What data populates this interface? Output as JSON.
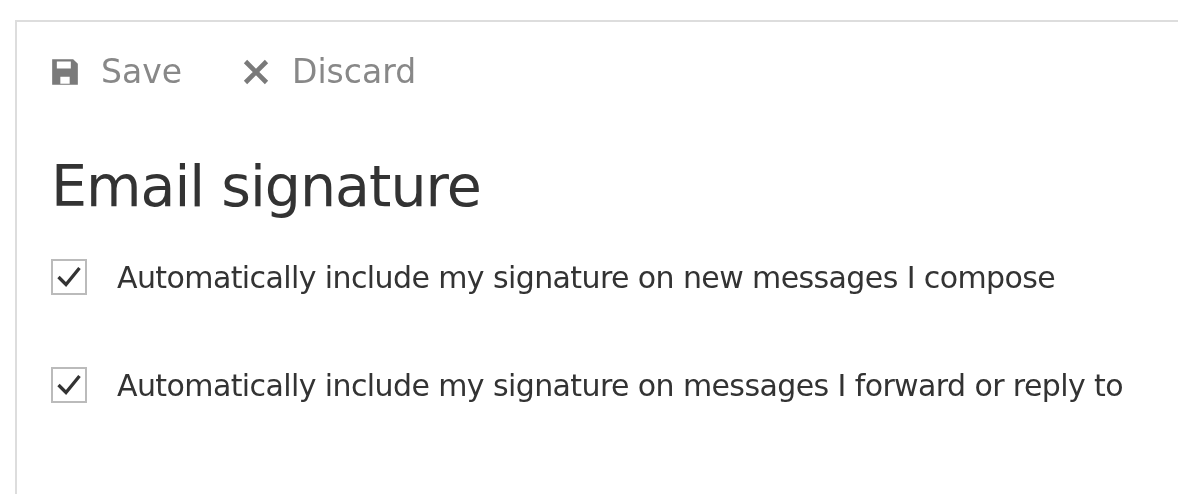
{
  "toolbar": [
    {
      "kind": "save",
      "label": "Save"
    },
    {
      "kind": "discard",
      "label": "Discard"
    }
  ],
  "heading": "Email signature",
  "options": [
    {
      "label": "Automatically include my signature on new messages I compose",
      "checked": true
    },
    {
      "label": "Automatically include my signature on messages I forward or reply to",
      "checked": true
    }
  ]
}
